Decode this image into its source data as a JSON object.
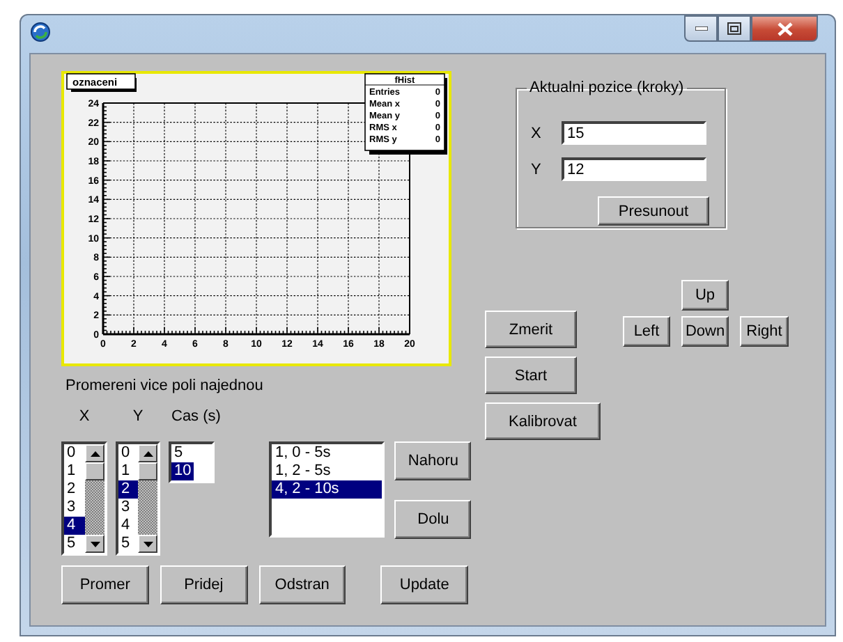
{
  "chart": {
    "chart_data": {
      "type": "scatter",
      "title": "oznaceni",
      "grid": true,
      "xlim": [
        0,
        20
      ],
      "ylim": [
        0,
        24
      ],
      "xticks": [
        0,
        2,
        4,
        6,
        8,
        10,
        12,
        14,
        16,
        18,
        20
      ],
      "yticks": [
        0,
        2,
        4,
        6,
        8,
        10,
        12,
        14,
        16,
        18,
        20,
        22,
        24
      ]
    },
    "stats": {
      "title": "fHist",
      "rows": [
        {
          "label": "Entries",
          "value": "0"
        },
        {
          "label": "Mean x",
          "value": "0"
        },
        {
          "label": "Mean y",
          "value": "0"
        },
        {
          "label": "RMS x",
          "value": "0"
        },
        {
          "label": "RMS y",
          "value": "0"
        }
      ]
    }
  },
  "multi": {
    "title": "Promereni vice poli najednou",
    "columns": [
      {
        "label": "X",
        "kind": "scroll",
        "items": [
          {
            "text": "0",
            "selected": false
          },
          {
            "text": "1",
            "selected": false
          },
          {
            "text": "2",
            "selected": false
          },
          {
            "text": "3",
            "selected": false
          },
          {
            "text": "4",
            "selected": true
          },
          {
            "text": "5",
            "selected": false
          }
        ]
      },
      {
        "label": "Y",
        "kind": "scroll",
        "items": [
          {
            "text": "0",
            "selected": false
          },
          {
            "text": "1",
            "selected": false
          },
          {
            "text": "2",
            "selected": true
          },
          {
            "text": "3",
            "selected": false
          },
          {
            "text": "4",
            "selected": false
          },
          {
            "text": "5",
            "selected": false
          }
        ]
      },
      {
        "label": "Cas (s)",
        "kind": "plain",
        "items": [
          {
            "text": "5",
            "selected": false
          },
          {
            "text": "10",
            "selected": true
          }
        ]
      }
    ],
    "queue": [
      {
        "text": "1, 0 - 5s",
        "selected": false
      },
      {
        "text": "1, 2 - 5s",
        "selected": false
      },
      {
        "text": "4, 2 - 10s",
        "selected": true
      }
    ],
    "queue_buttons": [
      "Nahoru",
      "Dolu"
    ],
    "buttons": [
      "Promer",
      "Pridej",
      "Odstran",
      "Update"
    ]
  },
  "position": {
    "title": "Aktualni pozice (kroky)",
    "fields": [
      {
        "label": "X",
        "value": "15"
      },
      {
        "label": "Y",
        "value": "12"
      }
    ],
    "button": "Presunout"
  },
  "action_buttons": [
    "Zmerit",
    "Start",
    "Kalibrovat"
  ],
  "direction_buttons": [
    "Up",
    "Left",
    "Down",
    "Right"
  ]
}
